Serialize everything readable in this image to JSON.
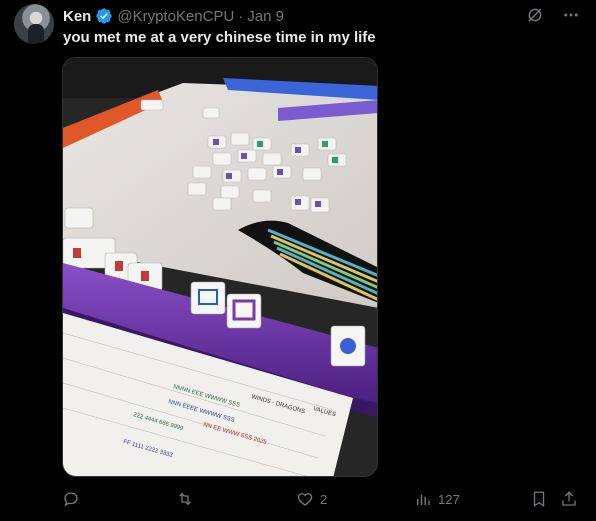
{
  "author": {
    "name": "Ken",
    "handle": "@KryptoKenCPU",
    "separator": "·",
    "date": "Jan 9"
  },
  "tweet": {
    "text": "you met me at a very chinese time in my life"
  },
  "header_icons": [
    "grok-icon",
    "more-icon"
  ],
  "media": {
    "scorecard_lines": [
      "WINDS - DRAGONS",
      "VALUES",
      "NNNN EEE WWWW SSS",
      "NNN EEEE WWWW SSS",
      "NN EE WWW SSS 2025",
      "222 4444 666 9999",
      "FF 1111 2222 3333"
    ]
  },
  "actions": {
    "replies": "",
    "retweets": "",
    "likes": "2",
    "views": "127"
  },
  "colors": {
    "background": "#000000",
    "text": "#e7e9ea",
    "muted": "#71767b",
    "verified": "#1d9bf0"
  }
}
